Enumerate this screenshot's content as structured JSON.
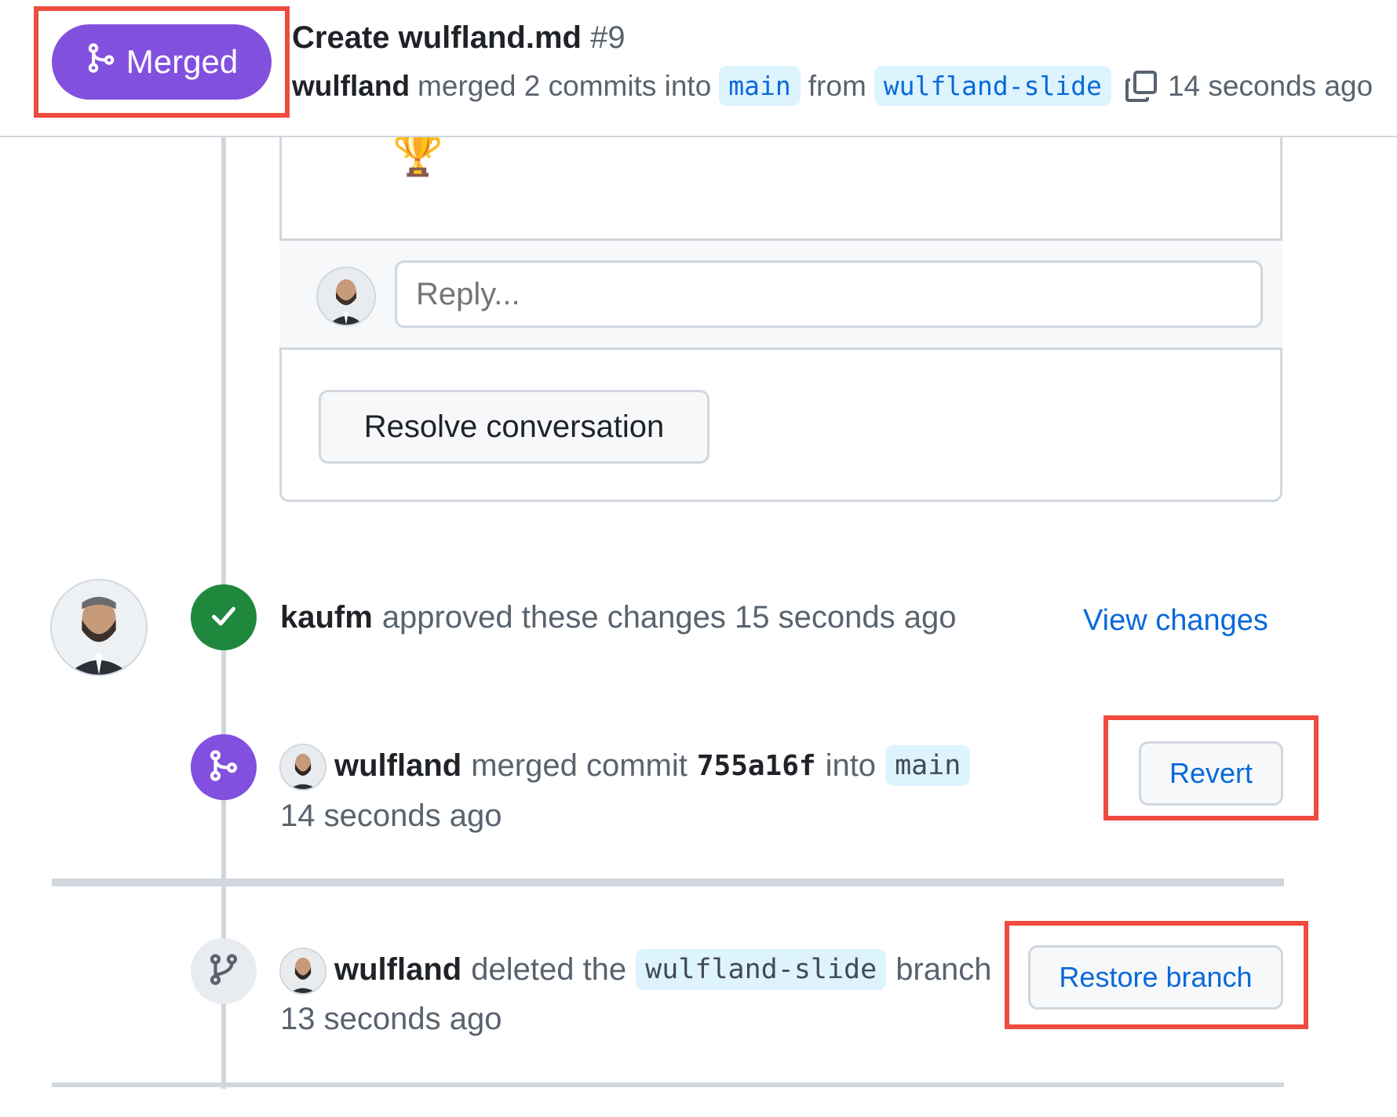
{
  "header": {
    "state_label": "Merged",
    "title": "Create wulfland.md",
    "number": "#9",
    "author": "wulfland",
    "merge_text": "merged 2 commits into",
    "base_branch": "main",
    "from_text": "from",
    "head_branch": "wulfland-slide",
    "time": "14 seconds ago"
  },
  "comment": {
    "emoji": "🏆",
    "reply_placeholder": "Reply...",
    "resolve_label": "Resolve conversation"
  },
  "timeline": {
    "approval": {
      "user": "kaufm",
      "text": "approved these changes 15 seconds ago",
      "link": "View changes"
    },
    "merge": {
      "user": "wulfland",
      "text": "merged commit",
      "commit": "755a16f",
      "into_text": "into",
      "branch": "main",
      "time": "14 seconds ago",
      "button": "Revert"
    },
    "delete": {
      "user": "wulfland",
      "text": "deleted the",
      "branch": "wulfland-slide",
      "suffix": "branch",
      "time": "13 seconds ago",
      "button": "Restore branch"
    }
  },
  "colors": {
    "merged_purple": "#8250df",
    "approve_green": "#1f883d",
    "link_blue": "#0969da",
    "highlight_red": "#ef4b3f"
  }
}
